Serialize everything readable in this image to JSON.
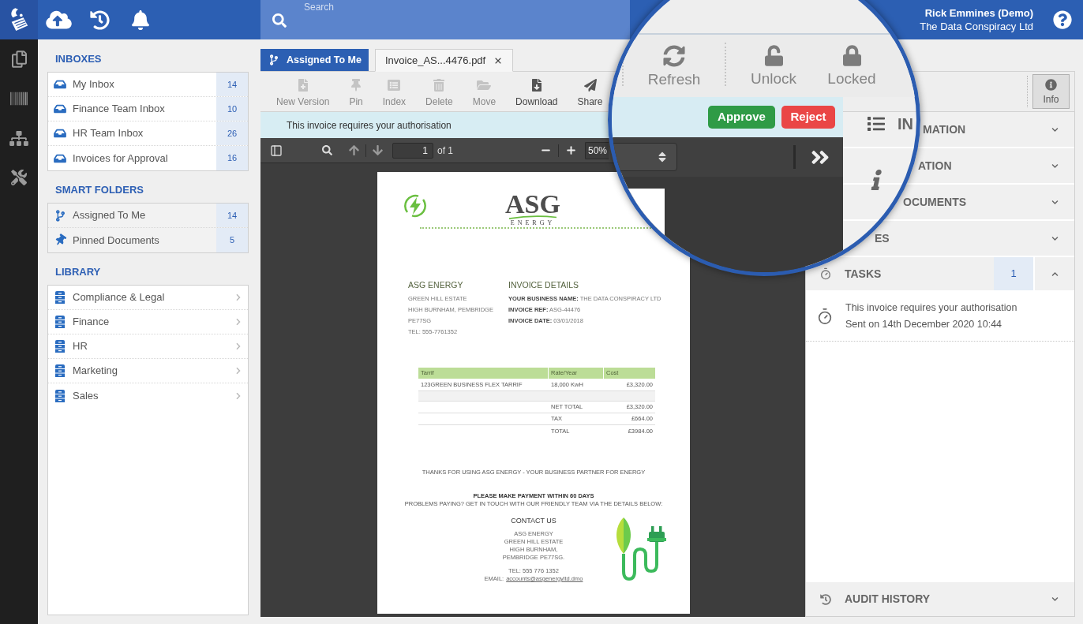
{
  "header": {
    "search": {
      "placeholder": "Search"
    },
    "user": {
      "name": "Rick Emmines (Demo)",
      "company": "The Data Conspiracy Ltd"
    }
  },
  "sidebar": {
    "sections": [
      {
        "title": "INBOXES",
        "kind": "inbox",
        "items": [
          {
            "label": "My Inbox",
            "count": "14",
            "kind": "inbox"
          },
          {
            "label": "Finance Team Inbox",
            "count": "10",
            "kind": "inbox"
          },
          {
            "label": "HR Team Inbox",
            "count": "26",
            "kind": "inbox"
          },
          {
            "label": "Invoices for Approval",
            "count": "16",
            "kind": "inbox"
          }
        ]
      },
      {
        "title": "SMART FOLDERS",
        "kind": "smart",
        "items": [
          {
            "label": "Assigned To Me",
            "count": "14",
            "kind": "branch"
          },
          {
            "label": "Pinned Documents",
            "count": "5",
            "kind": "pin"
          }
        ]
      },
      {
        "title": "LIBRARY",
        "kind": "library",
        "items": [
          {
            "label": "Compliance & Legal",
            "kind": "cabinet"
          },
          {
            "label": "Finance",
            "kind": "cabinet"
          },
          {
            "label": "HR",
            "kind": "cabinet"
          },
          {
            "label": "Marketing",
            "kind": "cabinet"
          },
          {
            "label": "Sales",
            "kind": "cabinet"
          }
        ]
      }
    ]
  },
  "breadcrumb": {
    "label": "Assigned To Me"
  },
  "tabs": [
    {
      "label": "Invoice_AS...4476.pdf",
      "selected": true
    }
  ],
  "toolbar": {
    "items": [
      {
        "label": "New Version",
        "kind": "version",
        "disabled": true
      },
      {
        "label": "Pin",
        "kind": "pin",
        "disabled": true
      },
      {
        "label": "Index",
        "kind": "index",
        "disabled": true
      },
      {
        "label": "Delete",
        "kind": "delete",
        "disabled": true
      },
      {
        "label": "Move",
        "kind": "move",
        "disabled": true
      },
      {
        "label": "Download",
        "kind": "download",
        "disabled": false
      },
      {
        "label": "Share",
        "kind": "share",
        "disabled": false
      }
    ]
  },
  "notice": {
    "text": "This invoice requires your authorisation"
  },
  "pdf_toolbar": {
    "page": "1",
    "page_count": "of 1",
    "zoom": "50%"
  },
  "document": {
    "logo": {
      "wordmark": "ASG",
      "tagline": "ENERGY"
    },
    "sender": {
      "name": "ASG ENERGY",
      "lines": [
        "GREEN HILL ESTATE",
        "HIGH BURNHAM, PEMBRIDGE",
        "PE77SG",
        "TEL: 555-7761352"
      ]
    },
    "details": {
      "title": "INVOICE DETAILS",
      "lines": [
        "**YOUR BUSINESS NAME:** THE DATA CONSPIRACY LTD",
        "**INVOICE REF:** ASG-44476",
        "**INVOICE DATE:** 03/01/2018"
      ]
    },
    "table": {
      "columns": [
        "Tarrif",
        "Rate/Year",
        "Cost"
      ],
      "rows": [
        [
          "123GREEN BUSINESS FLEX TARRIF",
          "18,000 KwH",
          "£3,320.00"
        ]
      ],
      "totals": [
        {
          "label": "NET TOTAL",
          "value": "£3,320.00"
        },
        {
          "label": "TAX",
          "value": "£664.00"
        },
        {
          "label": "TOTAL",
          "value": "£3984.00"
        }
      ]
    },
    "thanks": "THANKS FOR USING ASG ENERGY - YOUR BUSINESS PARTNER FOR ENERGY",
    "payment": "PLEASE MAKE PAYMENT WITHIN 60 DAYS",
    "problems": "PROBLEMS PAYING? GET IN TOUCH WITH OUR FRIENDLY TEAM VIA THE DETAILS BELOW:",
    "contact": {
      "title": "CONTACT US",
      "lines": [
        "ASG ENERGY",
        "GREEN HILL ESTATE",
        "HIGH BURNHAM,",
        "PEMBRIDGE PE77SG."
      ],
      "tel": "TEL: 555 776 1352",
      "email_label": "EMAIL:",
      "email": "accounts@asgenergyltd.dmo"
    }
  },
  "magnifier": {
    "toolbar": [
      {
        "label": "Refresh",
        "kind": "refresh"
      },
      {
        "label": "Unlock",
        "kind": "unlock"
      },
      {
        "label": "Locked",
        "kind": "lock"
      }
    ],
    "actions": [
      {
        "label": "Approve",
        "kind": "approve"
      },
      {
        "label": "Reject",
        "kind": "reject"
      }
    ],
    "panel_label": "IN"
  },
  "info_button": {
    "label": "Info",
    "selected": true
  },
  "panel": {
    "sections": [
      {
        "label": "MATION",
        "kind": "clipped",
        "expanded": false
      },
      {
        "label": "ATION",
        "kind": "clipped",
        "expanded": false
      },
      {
        "label": "OCUMENTS",
        "kind": "clipped",
        "expanded": false
      },
      {
        "label": "ES",
        "kind": "clipped",
        "expanded": false
      },
      {
        "label": "TASKS",
        "kind": "tasks",
        "count": "1",
        "expanded": true,
        "tasks": [
          {
            "title": "This invoice requires your authorisation",
            "sent": "Sent on 14th December 2020 10:44"
          }
        ]
      },
      {
        "label": "AUDIT HISTORY",
        "kind": "history",
        "expanded": false
      }
    ]
  }
}
